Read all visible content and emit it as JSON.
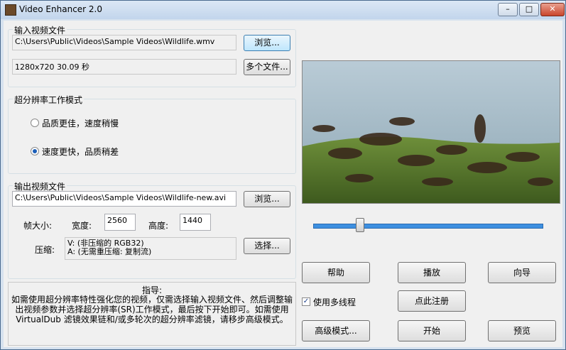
{
  "window": {
    "title": "Video Enhancer 2.0",
    "min_glyph": "–",
    "max_glyph": "□",
    "close_glyph": "✕"
  },
  "input": {
    "group_label": "输入视频文件",
    "path": "C:\\Users\\Public\\Videos\\Sample Videos\\Wildlife.wmv",
    "browse_label": "浏览...",
    "info": "1280x720 30.09 秒",
    "multi_label": "多个文件..."
  },
  "mode": {
    "group_label": "超分辨率工作模式",
    "option_quality": "品质更佳，速度稍慢",
    "option_speed": "速度更快，品质稍差",
    "selected": "speed"
  },
  "output": {
    "group_label": "输出视频文件",
    "path": "C:\\Users\\Public\\Videos\\Sample Videos\\Wildlife-new.avi",
    "browse_label": "浏览...",
    "frame_size_label": "帧大小:",
    "width_label": "宽度:",
    "width_value": "2560",
    "height_label": "高度:",
    "height_value": "1440",
    "compress_label": "压缩:",
    "compress_video": "V: (非压缩的 RGB32)",
    "compress_audio": "A: (无需重压缩: 复制流)",
    "select_label": "选择..."
  },
  "guide": {
    "title": "指导:",
    "text": "如需使用超分辨率特性强化您的视频，仅需选择输入视频文件、然后调整输出视频参数并选择超分辨率(SR)工作模式，最后按下开始即可。如需使用 VirtualDub 滤镜效果链和/或多轮次的超分辨率滤镜，请移步高级模式。"
  },
  "controls": {
    "help": "帮助",
    "play": "播放",
    "wizard": "向导",
    "multithread": "使用多线程",
    "multithread_checked": true,
    "register": "点此注册",
    "advanced": "高级模式...",
    "start": "开始",
    "preview": "预览"
  },
  "slider": {
    "position_fraction": 0.19
  },
  "colors": {
    "accent": "#3d8fe0",
    "titlebar": "#c2d5ec",
    "close": "#c9452c"
  }
}
